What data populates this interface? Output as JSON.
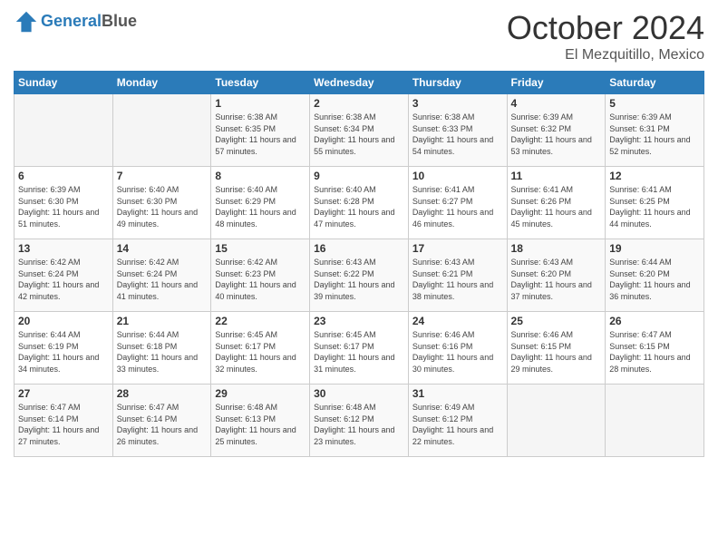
{
  "header": {
    "logo_line1": "General",
    "logo_line2": "Blue",
    "month": "October 2024",
    "location": "El Mezquitillo, Mexico"
  },
  "weekdays": [
    "Sunday",
    "Monday",
    "Tuesday",
    "Wednesday",
    "Thursday",
    "Friday",
    "Saturday"
  ],
  "weeks": [
    [
      {
        "day": "",
        "info": ""
      },
      {
        "day": "",
        "info": ""
      },
      {
        "day": "1",
        "info": "Sunrise: 6:38 AM\nSunset: 6:35 PM\nDaylight: 11 hours and 57 minutes."
      },
      {
        "day": "2",
        "info": "Sunrise: 6:38 AM\nSunset: 6:34 PM\nDaylight: 11 hours and 55 minutes."
      },
      {
        "day": "3",
        "info": "Sunrise: 6:38 AM\nSunset: 6:33 PM\nDaylight: 11 hours and 54 minutes."
      },
      {
        "day": "4",
        "info": "Sunrise: 6:39 AM\nSunset: 6:32 PM\nDaylight: 11 hours and 53 minutes."
      },
      {
        "day": "5",
        "info": "Sunrise: 6:39 AM\nSunset: 6:31 PM\nDaylight: 11 hours and 52 minutes."
      }
    ],
    [
      {
        "day": "6",
        "info": "Sunrise: 6:39 AM\nSunset: 6:30 PM\nDaylight: 11 hours and 51 minutes."
      },
      {
        "day": "7",
        "info": "Sunrise: 6:40 AM\nSunset: 6:30 PM\nDaylight: 11 hours and 49 minutes."
      },
      {
        "day": "8",
        "info": "Sunrise: 6:40 AM\nSunset: 6:29 PM\nDaylight: 11 hours and 48 minutes."
      },
      {
        "day": "9",
        "info": "Sunrise: 6:40 AM\nSunset: 6:28 PM\nDaylight: 11 hours and 47 minutes."
      },
      {
        "day": "10",
        "info": "Sunrise: 6:41 AM\nSunset: 6:27 PM\nDaylight: 11 hours and 46 minutes."
      },
      {
        "day": "11",
        "info": "Sunrise: 6:41 AM\nSunset: 6:26 PM\nDaylight: 11 hours and 45 minutes."
      },
      {
        "day": "12",
        "info": "Sunrise: 6:41 AM\nSunset: 6:25 PM\nDaylight: 11 hours and 44 minutes."
      }
    ],
    [
      {
        "day": "13",
        "info": "Sunrise: 6:42 AM\nSunset: 6:24 PM\nDaylight: 11 hours and 42 minutes."
      },
      {
        "day": "14",
        "info": "Sunrise: 6:42 AM\nSunset: 6:24 PM\nDaylight: 11 hours and 41 minutes."
      },
      {
        "day": "15",
        "info": "Sunrise: 6:42 AM\nSunset: 6:23 PM\nDaylight: 11 hours and 40 minutes."
      },
      {
        "day": "16",
        "info": "Sunrise: 6:43 AM\nSunset: 6:22 PM\nDaylight: 11 hours and 39 minutes."
      },
      {
        "day": "17",
        "info": "Sunrise: 6:43 AM\nSunset: 6:21 PM\nDaylight: 11 hours and 38 minutes."
      },
      {
        "day": "18",
        "info": "Sunrise: 6:43 AM\nSunset: 6:20 PM\nDaylight: 11 hours and 37 minutes."
      },
      {
        "day": "19",
        "info": "Sunrise: 6:44 AM\nSunset: 6:20 PM\nDaylight: 11 hours and 36 minutes."
      }
    ],
    [
      {
        "day": "20",
        "info": "Sunrise: 6:44 AM\nSunset: 6:19 PM\nDaylight: 11 hours and 34 minutes."
      },
      {
        "day": "21",
        "info": "Sunrise: 6:44 AM\nSunset: 6:18 PM\nDaylight: 11 hours and 33 minutes."
      },
      {
        "day": "22",
        "info": "Sunrise: 6:45 AM\nSunset: 6:17 PM\nDaylight: 11 hours and 32 minutes."
      },
      {
        "day": "23",
        "info": "Sunrise: 6:45 AM\nSunset: 6:17 PM\nDaylight: 11 hours and 31 minutes."
      },
      {
        "day": "24",
        "info": "Sunrise: 6:46 AM\nSunset: 6:16 PM\nDaylight: 11 hours and 30 minutes."
      },
      {
        "day": "25",
        "info": "Sunrise: 6:46 AM\nSunset: 6:15 PM\nDaylight: 11 hours and 29 minutes."
      },
      {
        "day": "26",
        "info": "Sunrise: 6:47 AM\nSunset: 6:15 PM\nDaylight: 11 hours and 28 minutes."
      }
    ],
    [
      {
        "day": "27",
        "info": "Sunrise: 6:47 AM\nSunset: 6:14 PM\nDaylight: 11 hours and 27 minutes."
      },
      {
        "day": "28",
        "info": "Sunrise: 6:47 AM\nSunset: 6:14 PM\nDaylight: 11 hours and 26 minutes."
      },
      {
        "day": "29",
        "info": "Sunrise: 6:48 AM\nSunset: 6:13 PM\nDaylight: 11 hours and 25 minutes."
      },
      {
        "day": "30",
        "info": "Sunrise: 6:48 AM\nSunset: 6:12 PM\nDaylight: 11 hours and 23 minutes."
      },
      {
        "day": "31",
        "info": "Sunrise: 6:49 AM\nSunset: 6:12 PM\nDaylight: 11 hours and 22 minutes."
      },
      {
        "day": "",
        "info": ""
      },
      {
        "day": "",
        "info": ""
      }
    ]
  ]
}
